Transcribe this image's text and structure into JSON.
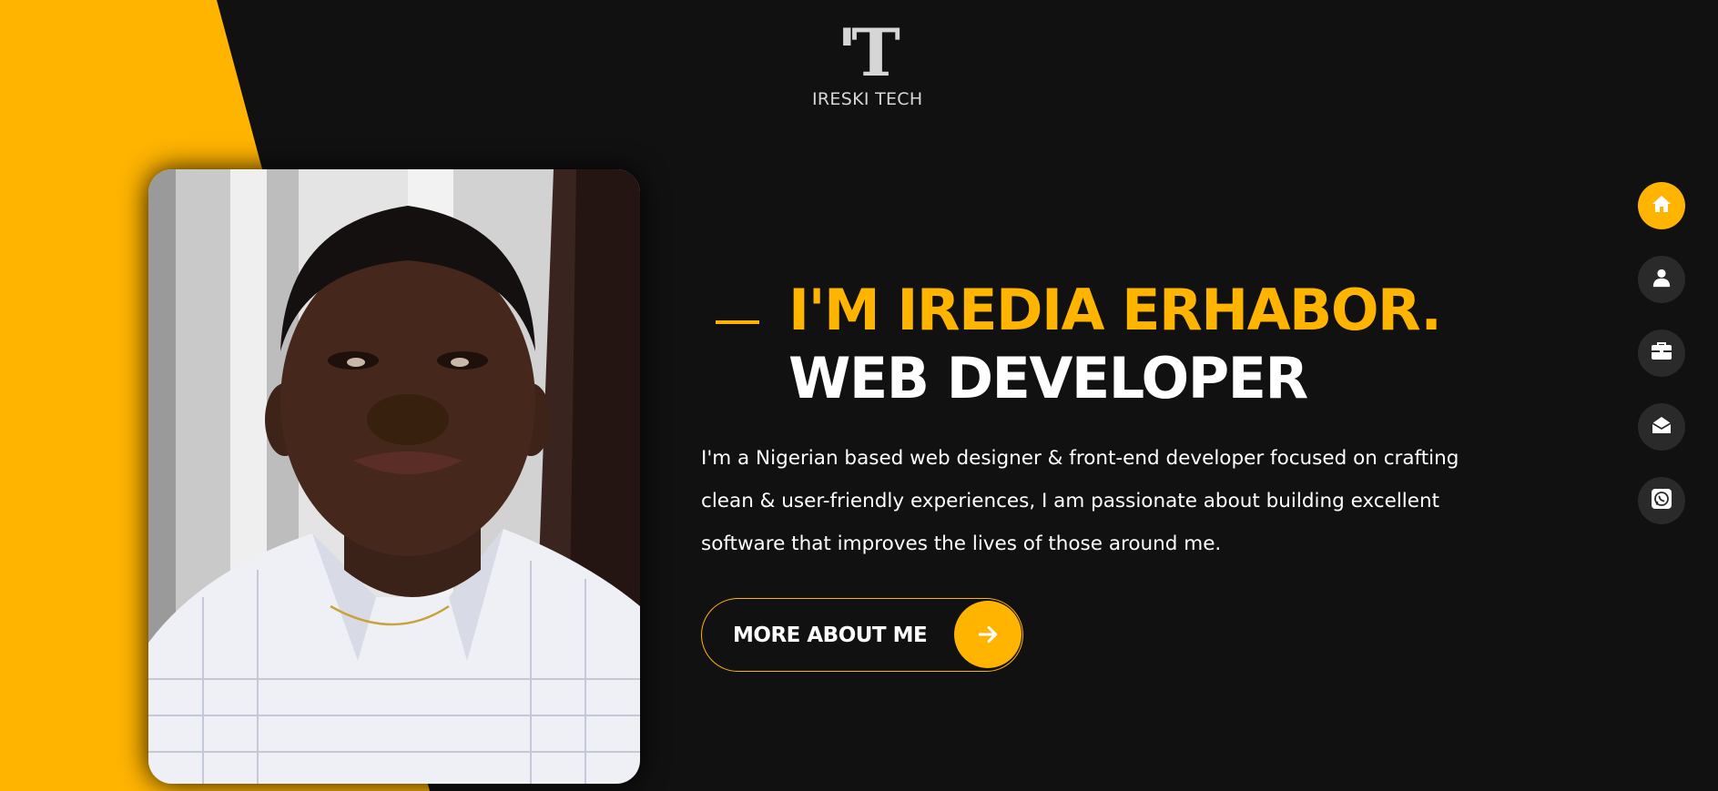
{
  "colors": {
    "accent": "#ffb400",
    "background": "#111111",
    "nav_inactive": "#2b2a2a"
  },
  "logo": {
    "mark": "'T",
    "text": "IRESKI TECH"
  },
  "hero": {
    "headline_accent": "I'M IREDIA ERHABOR.",
    "headline_role": "WEB DEVELOPER",
    "bio": "I'm a Nigerian based web designer & front-end developer focused on crafting clean & user-friendly experiences, I am passionate about building excellent software that improves the lives of those around me.",
    "cta_label": "MORE ABOUT ME",
    "cta_icon": "arrow-right-icon"
  },
  "nav": {
    "items": [
      {
        "icon": "home-icon",
        "active": true
      },
      {
        "icon": "user-icon",
        "active": false
      },
      {
        "icon": "briefcase-icon",
        "active": false
      },
      {
        "icon": "envelope-open-icon",
        "active": false
      },
      {
        "icon": "whatsapp-icon",
        "active": false
      }
    ]
  }
}
